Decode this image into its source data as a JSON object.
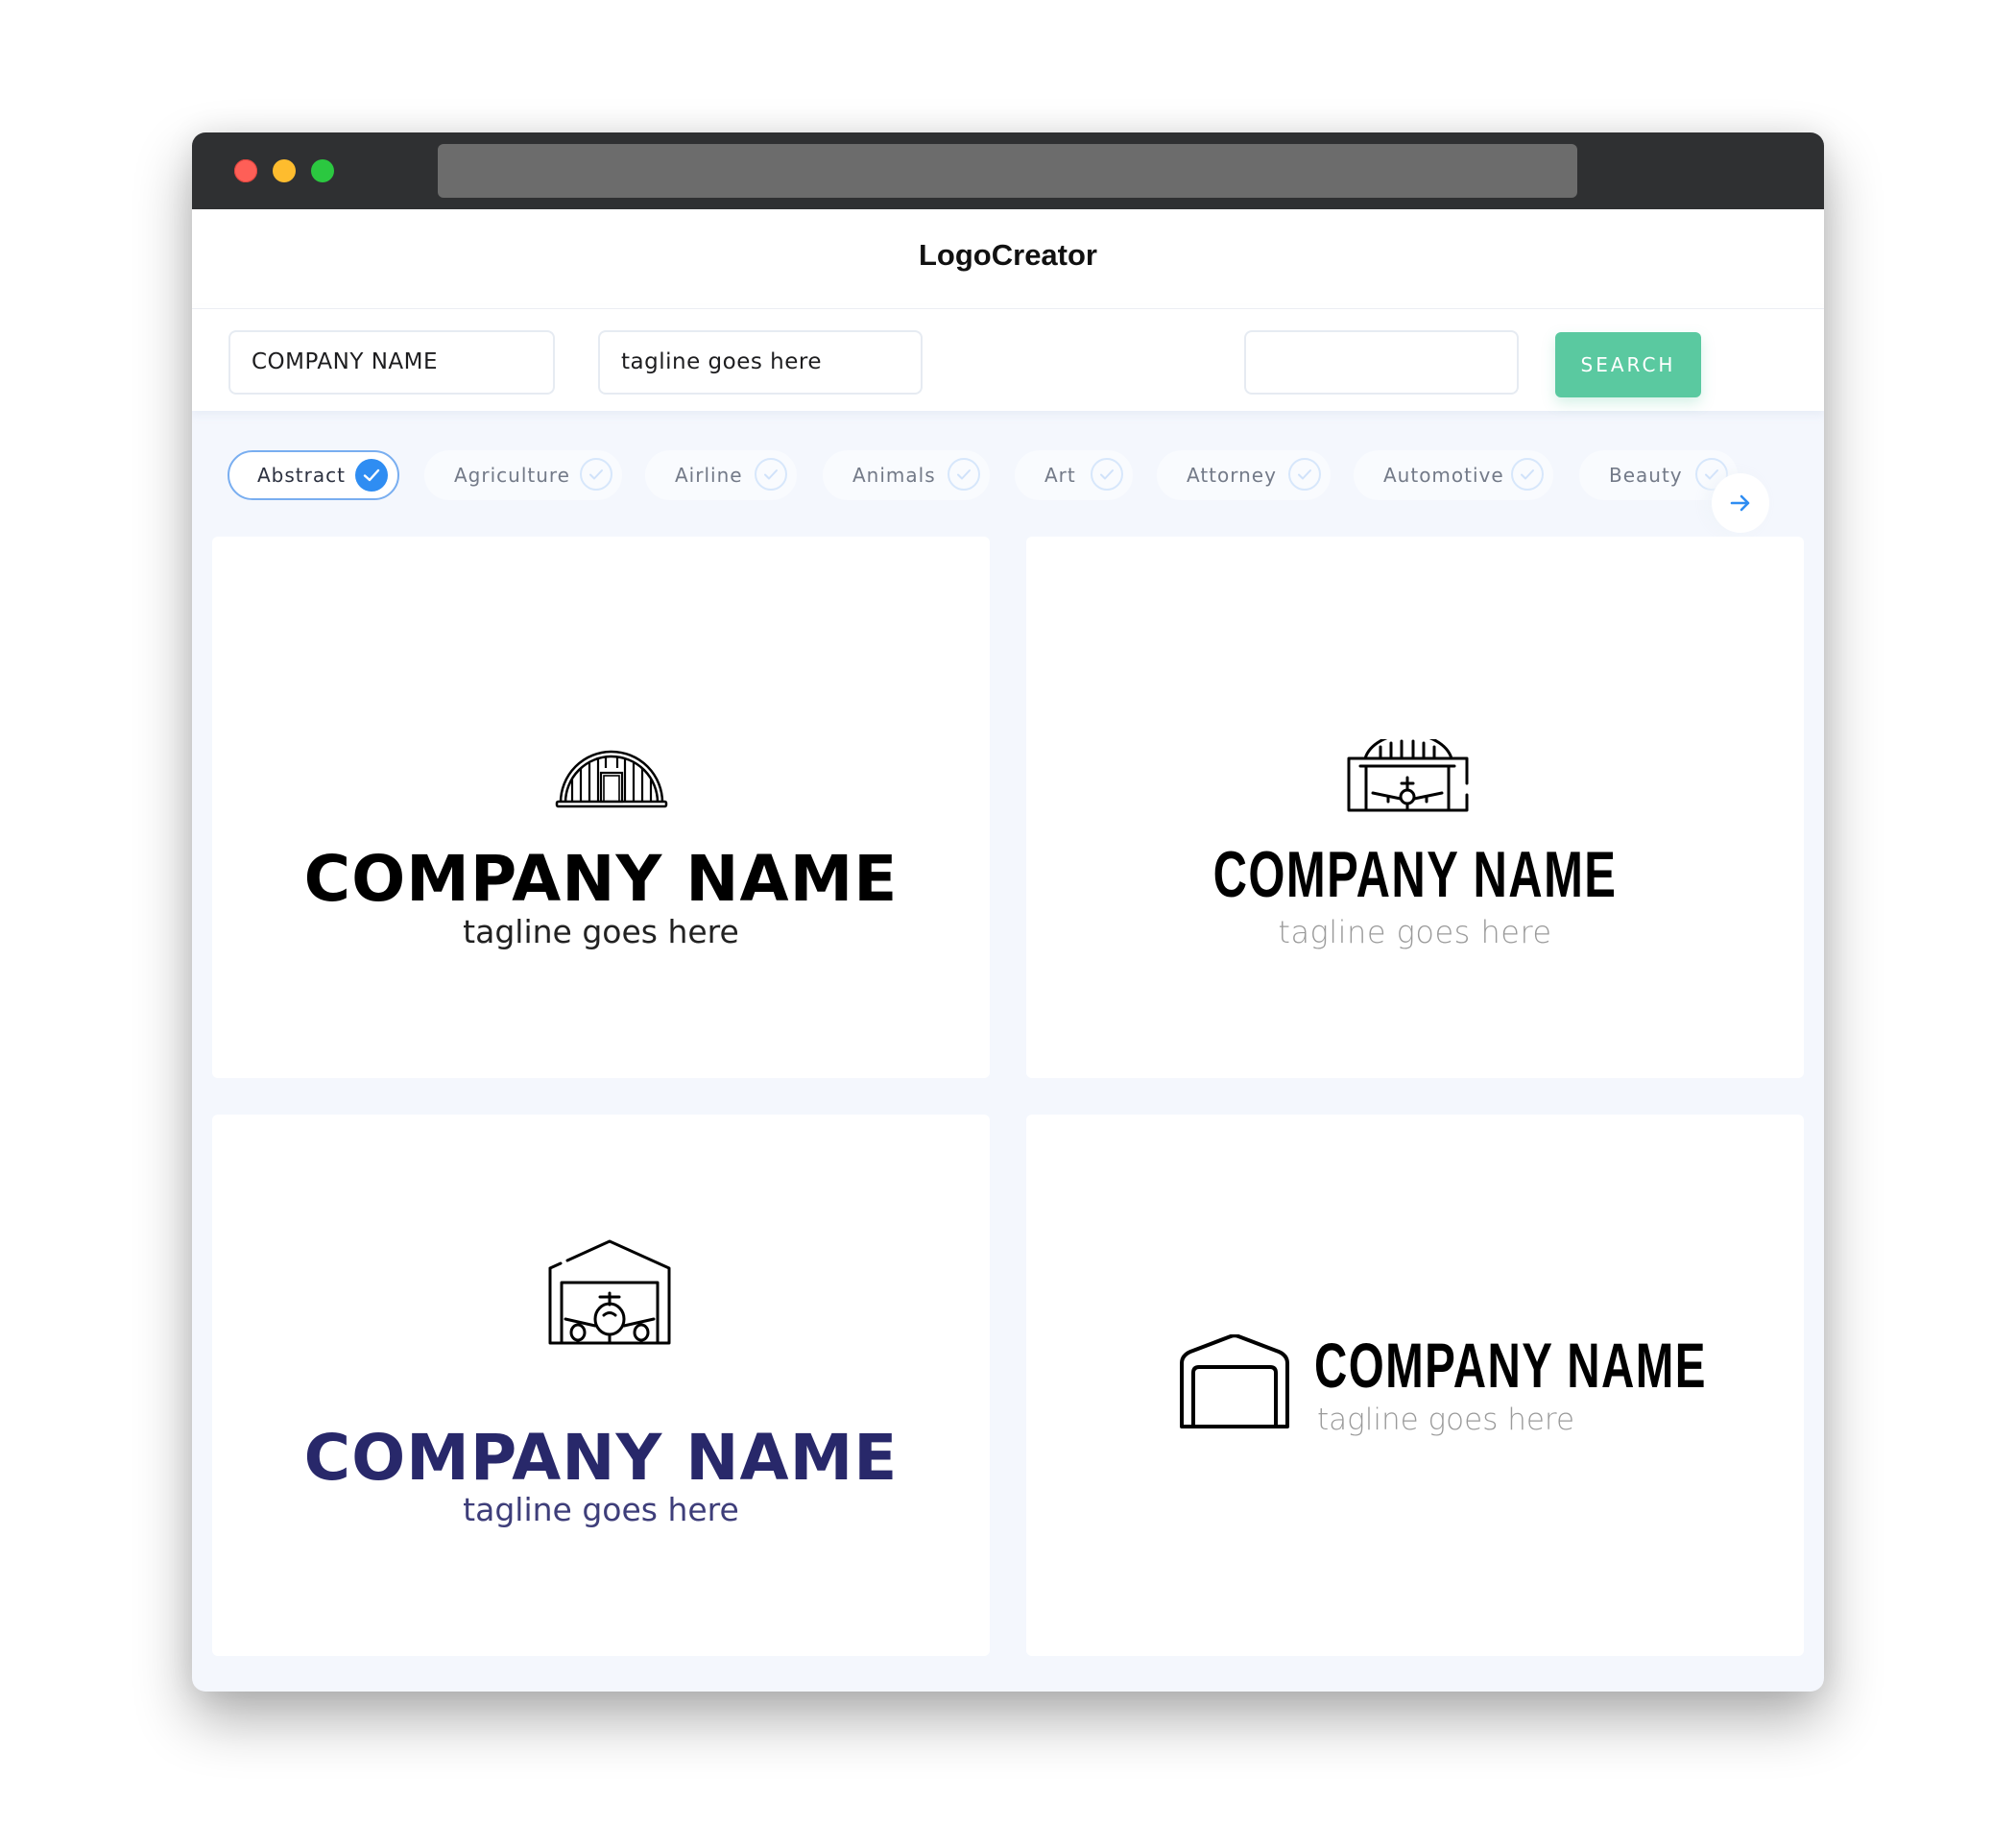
{
  "app": {
    "title": "LogoCreator",
    "window_controls": [
      "close",
      "minimize",
      "maximize"
    ]
  },
  "search": {
    "company_name_value": "COMPANY NAME",
    "tagline_value": "tagline goes here",
    "keyword_value": "",
    "search_label": "SEARCH"
  },
  "categories": {
    "items": [
      {
        "label": "Abstract",
        "selected": true
      },
      {
        "label": "Agriculture",
        "selected": false
      },
      {
        "label": "Airline",
        "selected": false
      },
      {
        "label": "Animals",
        "selected": false
      },
      {
        "label": "Art",
        "selected": false
      },
      {
        "label": "Attorney",
        "selected": false
      },
      {
        "label": "Automotive",
        "selected": false
      },
      {
        "label": "Beauty",
        "selected": false
      }
    ],
    "next_icon": "arrow-right-icon"
  },
  "logos": [
    {
      "icon": "quonset-hangar-icon",
      "company": "COMPANY NAME",
      "tagline": "tagline goes here",
      "name_color": "#000000",
      "tagline_color": "#222222"
    },
    {
      "icon": "hangar-airplane-icon",
      "company": "COMPANY NAME",
      "tagline": "tagline goes here",
      "name_color": "#000000",
      "tagline_color": "#9a9a9a"
    },
    {
      "icon": "hangar-house-airplane-icon",
      "company": "COMPANY NAME",
      "tagline": "tagline goes here",
      "name_color": "#28286a",
      "tagline_color": "#3e3e7a"
    },
    {
      "icon": "garage-icon",
      "company": "COMPANY NAME",
      "tagline": "tagline goes here",
      "name_color": "#000000",
      "tagline_color": "#9a9a9a"
    }
  ],
  "colors": {
    "accent": "#5ac9a0",
    "selected_chip": "#2f8df2",
    "titlebar": "#2f3032",
    "content_bg": "#f4f7fd"
  }
}
